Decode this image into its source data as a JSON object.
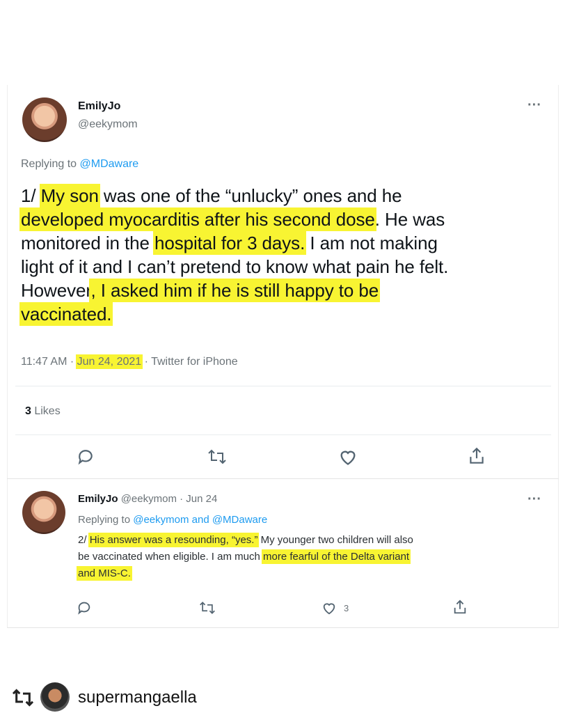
{
  "tweet1": {
    "name": "EmilyJo",
    "handle": "@eekymom",
    "more": "···",
    "replying_prefix": "Replying to ",
    "replying_to": "@MDaware",
    "text_parts": {
      "p0": "1/ ",
      "p1": "My son",
      "p2": " was one of the “unlucky” ones and he",
      "p3": "developed myocarditis after his second dose",
      "p4": ". He was",
      "p5": "monitored in the ",
      "p6": "hospital for 3 days.",
      "p7": " I am not making",
      "p8": "light of it and I can’t pretend to know what pain he felt.",
      "p9": "However",
      "p10": ", I asked him if he is still happy to be",
      "p11": "vaccinated."
    },
    "time": "11:47 AM · ",
    "date": "Jun 24, 2021",
    "sep": " · ",
    "source": "Twitter for iPhone",
    "likes_count": "3",
    "likes_label": " Likes"
  },
  "tweet2": {
    "name": "EmilyJo",
    "handle": "@eekymom",
    "date": " · Jun 24",
    "more": "···",
    "replying_prefix": "Replying to ",
    "replying_to": "@eekymom and @MDaware",
    "text_parts": {
      "p0": "2/ ",
      "p1": "His answer was a resounding, “yes.”",
      "p2": " My younger two children will also",
      "p3": "be vaccinated when eligible. I am much ",
      "p4": "more fearful of the Delta variant",
      "p5": "and MIS-C."
    },
    "like_count": "3"
  },
  "footer": {
    "username": "supermangaella"
  },
  "icons": {
    "reply": "reply-icon",
    "retweet": "retweet-icon",
    "like": "heart-icon",
    "share": "share-icon",
    "repost": "repost-icon",
    "avatar": "user-avatar"
  },
  "colors": {
    "highlight": "#f8f432",
    "link": "#1d9bf0",
    "muted": "#6b7378"
  }
}
